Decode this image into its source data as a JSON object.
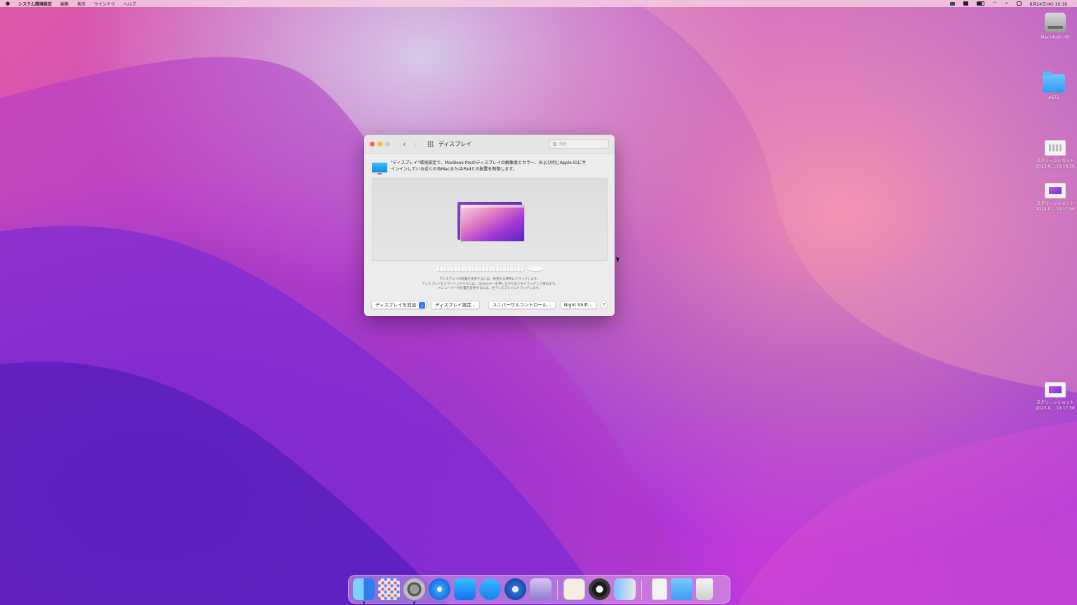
{
  "menubar": {
    "apple": "",
    "app_name": "システム環境設定",
    "menus": [
      "編集",
      "表示",
      "ウインドウ",
      "ヘルプ"
    ],
    "clock": "8月24日(木) 10:18",
    "status_icons": [
      "screen-mirroring-icon",
      "input-source-icon",
      "battery-icon",
      "wifi-icon",
      "spotlight-icon",
      "control-center-icon"
    ]
  },
  "desktop": {
    "icons": [
      {
        "label": "Macintosh HD",
        "icon": "hard-drive-icon"
      },
      {
        "label": "AST1",
        "icon": "folder-icon"
      },
      {
        "label_line1": "スクリーンショット",
        "label_line2": "2023-0....10.16.58",
        "icon": "screenshot-file-icon"
      },
      {
        "label_line1": "スクリーンショット",
        "label_line2": "2023-0....10.17.50",
        "icon": "screenshot-file-icon"
      },
      {
        "label_line1": "スクリーンショット",
        "label_line2": "2023-0....10.17.58",
        "icon": "screenshot-file-icon"
      }
    ]
  },
  "window": {
    "title": "ディスプレイ",
    "search_placeholder": "検索",
    "info_line1": "\"ディスプレイ\"環境設定で、MacBook Proのディスプレイの解像度とカラー、および同じApple IDにサ",
    "info_line2": "インインしている近くの各MacまたはiPadとの配置を制御します。",
    "hint_line1": "ディスプレイの配置を変更するには、希望する場所にドラッグします。",
    "hint_line2": "ディスプレイをミラーリングするには、Optionキーを押しながら互いをドラッグして重ねます。",
    "hint_line3": "メニューバーの位置を変更するには、主ディスプレイにドラッグします。",
    "buttons": {
      "add_display": "ディスプレイを追加",
      "display_settings": "ディスプレイ設定...",
      "universal_control": "ユニバーサルコントロール...",
      "night_shift": "Night Shift...",
      "help": "?"
    }
  },
  "dock": {
    "items": [
      "finder-icon",
      "launchpad-icon",
      "system-preferences-icon",
      "safari-icon",
      "app-store-icon",
      "cloud-app-icon",
      "network-utility-icon",
      "disk-utility-icon",
      "preview-icon",
      "quicktime-icon",
      "migration-assistant-icon",
      "document-icon",
      "downloads-folder-icon",
      "trash-icon"
    ]
  }
}
